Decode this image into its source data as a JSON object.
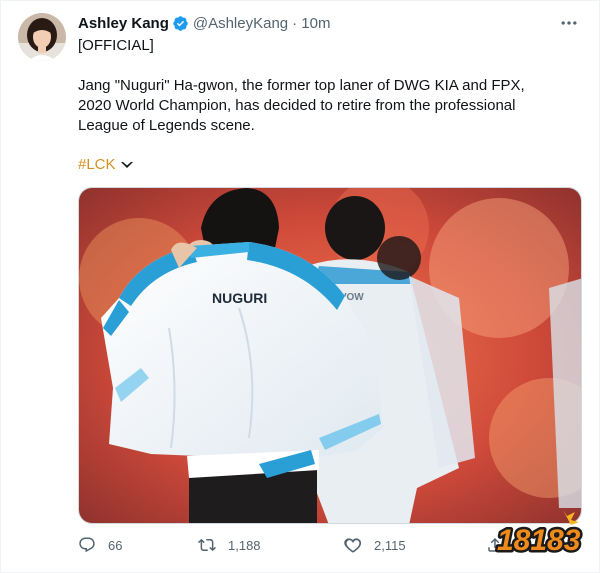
{
  "tweet": {
    "author_name": "Ashley Kang",
    "handle": "@AshleyKang",
    "time": "· 10m",
    "official_tag": "[OFFICIAL]",
    "body": "Jang \"Nuguri\" Ha-gwon, the former top laner of DWG KIA and FPX, 2020 World Champion, has decided to retire from the professional League of Legends scene.",
    "hashtag": "#LCK",
    "photo_jacket_text": "NUGURI"
  },
  "actions": {
    "reply_count": "66",
    "retweet_count": "1,188",
    "like_count": "2,115"
  },
  "watermark": {
    "text": "18183"
  },
  "colors": {
    "hashtag": "#d4911f",
    "verified": "#1d9bf0",
    "muted": "#536471",
    "jacket_blue": "#2a9fd6",
    "watermark_orange": "#f08a1a"
  },
  "icons": [
    "verified-badge-icon",
    "more-options-icon",
    "chevron-hashflag-icon",
    "reply-icon",
    "retweet-icon",
    "like-icon",
    "share-icon"
  ]
}
